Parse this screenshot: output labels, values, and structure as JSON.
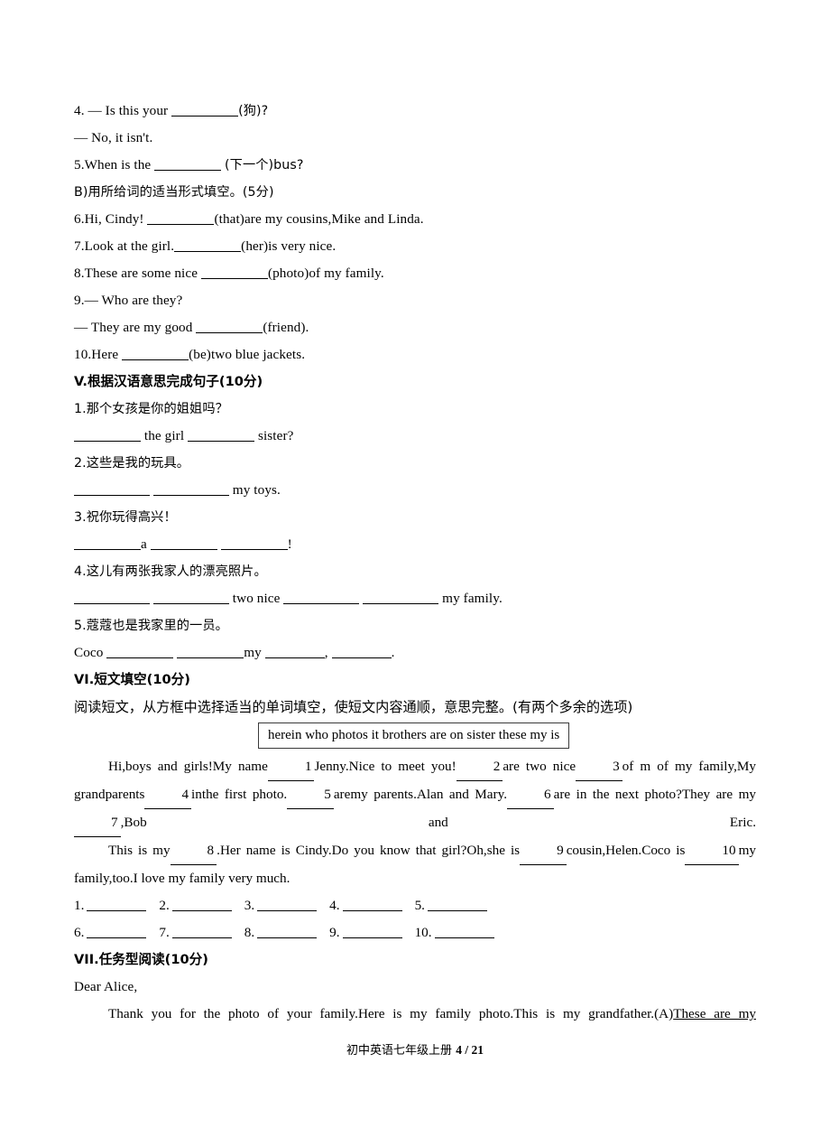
{
  "section_b": {
    "q4_line1_a": "4. — Is this your ",
    "q4_line1_b": "(狗)?",
    "q4_line2": "— No, it isn't.",
    "q5_a": "5.When is the ",
    "q5_b": "(下一个)bus?",
    "heading_b": "B)用所给词的适当形式填空。(5分)",
    "q6_a": "6.Hi, Cindy! ",
    "q6_b": "(that)are my cousins,Mike and Linda.",
    "q7_a": "7.Look at the girl.",
    "q7_b": "(her)is very nice.",
    "q8_a": "8.These are some nice ",
    "q8_b": "(photo)of my family.",
    "q9_line1": "9.— Who are they?",
    "q9_line2_a": "— They are my good ",
    "q9_line2_b": "(friend).",
    "q10_a": "10.Here ",
    "q10_b": "(be)two blue jackets."
  },
  "section_v": {
    "heading": "V.根据汉语意思完成句子(10分)",
    "items": [
      {
        "cn": "1.那个女孩是你的姐姐吗？",
        "en_parts": [
          "",
          " the girl ",
          " sister?"
        ]
      },
      {
        "cn": "2.这些是我的玩具。",
        "en_parts": [
          "",
          " ",
          " my toys."
        ]
      },
      {
        "cn": "3.祝你玩得高兴！",
        "en_parts": [
          "",
          "a ",
          " ",
          "!"
        ]
      },
      {
        "cn": "4.这儿有两张我家人的漂亮照片。",
        "en_parts": [
          "",
          " ",
          " two nice ",
          " ",
          " my family."
        ]
      },
      {
        "cn": "5.蔻蔻也是我家里的一员。",
        "en_parts": [
          "Coco ",
          " ",
          "my ",
          ", ",
          "."
        ]
      }
    ]
  },
  "section_vi": {
    "heading": "VI.短文填空(10分)",
    "instruction": "阅读短文，从方框中选择适当的单词填空，使短文内容通顺，意思完整。(有两个多余的选项)",
    "word_bank": "herein who photos it brothers are on sister these my is",
    "passage": {
      "p1_s1": "Hi,boys and girls!My name",
      "p1_n1": "1",
      "p1_s2": "Jenny.Nice to meet you!",
      "p1_n2": "2",
      "p1_s3": "are two nice",
      "p1_n3": "3",
      "p1_s4": "of m of my family,My grandparents",
      "p1_n4": "4",
      "p1_s5": "inthe first photo.",
      "p1_n5": "5",
      "p1_s6": "aremy parents.Alan and Mary.",
      "p1_n6": "6",
      "p1_s7": "are in the next photo?They are my",
      "p1_n7": "7",
      "p1_s8": ",Bob and Eric.",
      "p2_s1": "This is my",
      "p2_n8": "8",
      "p2_s2": ".Her name is Cindy.Do you know that girl?Oh,she is",
      "p2_n9": "9",
      "p2_s3": "cousin,Helen.Coco is",
      "p2_n10": "10",
      "p2_s4": "my family,too.I love my family very much."
    },
    "answer_numbers_row1": [
      "1.",
      "2.",
      "3.",
      "4.",
      "5."
    ],
    "answer_numbers_row2": [
      "6.",
      "7.",
      "8.",
      "9.",
      "10."
    ]
  },
  "section_vii": {
    "heading": "VII.任务型阅读(10分)",
    "salutation": "Dear Alice,",
    "body_plain": "Thank you for the photo of your family.Here is my family photo.This is my grandfather.(A)",
    "body_underlined": "These are my"
  },
  "footer": {
    "text_cn": "初中英语七年级上册 ",
    "page": "4 / 21"
  }
}
